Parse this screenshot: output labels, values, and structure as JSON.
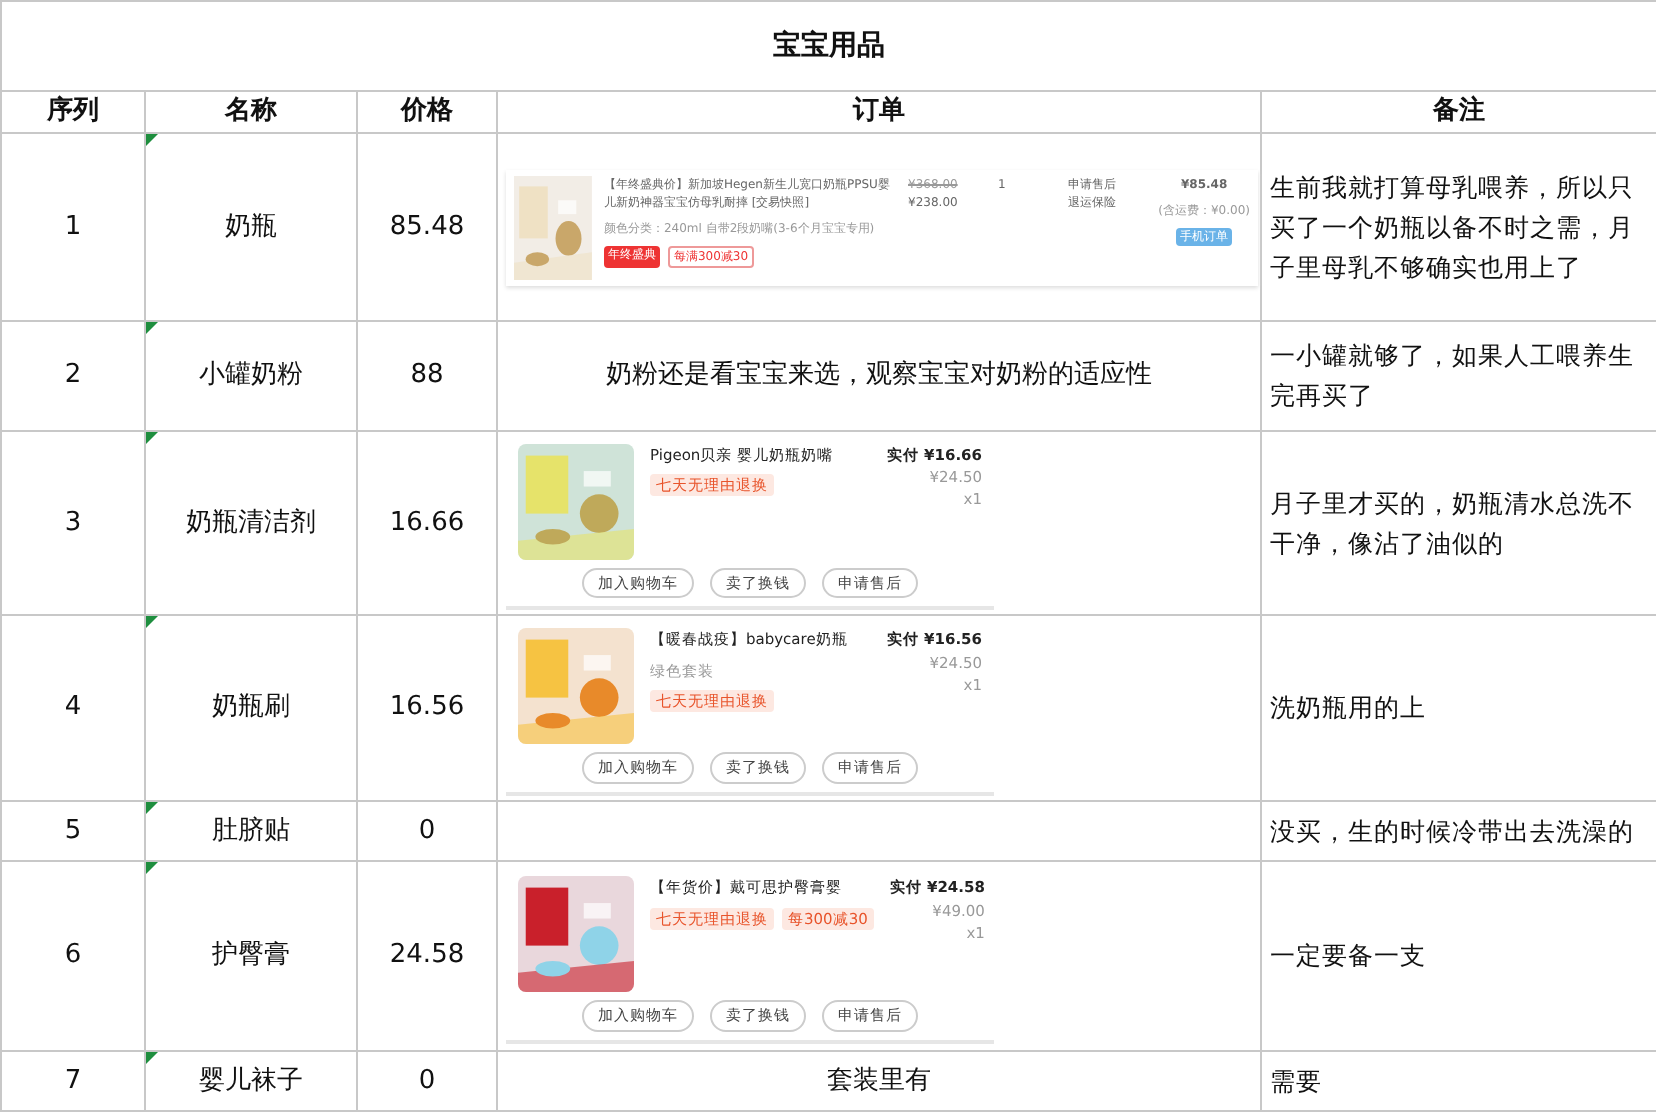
{
  "title": "宝宝用品",
  "columns": [
    "序列",
    "名称",
    "价格",
    "订单",
    "备注"
  ],
  "rows": [
    {
      "index": "1",
      "name": "奶瓶",
      "commented": true,
      "price": "85.48",
      "order": {
        "kind": "desktop",
        "title": "【年终盛典价】新加坡Hegen新生儿宽口奶瓶PPSU婴儿新奶神器宝宝仿母乳耐摔 [交易快照]",
        "variant": "颜色分类：240ml 自带2段奶嘴(3-6个月宝宝专用)",
        "tags": [
          "年终盛典",
          "每满300减30"
        ],
        "original": "¥368.00",
        "price": "¥238.00",
        "qty": "1",
        "links": [
          "申请售后",
          "退运保险"
        ],
        "total": "¥85.48",
        "shipping": "(含运费：¥0.00)",
        "badge": "手机订单"
      },
      "note": "生前我就打算母乳喂养，所以只买了一个奶瓶以备不时之需，月子里母乳不够确实也用上了"
    },
    {
      "index": "2",
      "name": "小罐奶粉",
      "commented": true,
      "price": "88",
      "order": {
        "kind": "text",
        "text": "奶粉还是看宝宝来选，观察宝宝对奶粉的适应性"
      },
      "note": "一小罐就够了，如果人工喂养生完再买了"
    },
    {
      "index": "3",
      "name": "奶瓶清洁剂",
      "commented": true,
      "price": "16.66",
      "order": {
        "kind": "mobile",
        "title": "Pigeon贝亲 婴儿奶瓶奶嘴",
        "tags": [
          "七天无理由退换"
        ],
        "paid": "实付 ¥16.66",
        "original": "¥24.50",
        "qty": "x1",
        "buttons": [
          "加入购物车",
          "卖了换钱",
          "申请售后"
        ]
      },
      "note": "月子里才买的，奶瓶清水总洗不干净，像沾了油似的"
    },
    {
      "index": "4",
      "name": "奶瓶刷",
      "commented": true,
      "price": "16.56",
      "order": {
        "kind": "mobile",
        "title": "【暖春战疫】babycare奶瓶",
        "variant": "绿色套装",
        "tags": [
          "七天无理由退换"
        ],
        "paid": "实付 ¥16.56",
        "original": "¥24.50",
        "qty": "x1",
        "buttons": [
          "加入购物车",
          "卖了换钱",
          "申请售后"
        ]
      },
      "note": "洗奶瓶用的上"
    },
    {
      "index": "5",
      "name": "肚脐贴",
      "commented": true,
      "price": "0",
      "note": "没买，生的时候冷带出去洗澡的"
    },
    {
      "index": "6",
      "name": "护臀膏",
      "commented": true,
      "price": "24.58",
      "order": {
        "kind": "mobile",
        "title": "【年货价】戴可思护臀膏婴",
        "tags": [
          "七天无理由退换",
          "每300减30"
        ],
        "paid": "实付 ¥24.58",
        "original": "¥49.00",
        "qty": "x1",
        "buttons": [
          "加入购物车",
          "卖了换钱",
          "申请售后"
        ]
      },
      "note": "一定要备一支"
    },
    {
      "index": "7",
      "name": "婴儿袜子",
      "commented": true,
      "price": "0",
      "order": {
        "kind": "text",
        "text": "套装里有"
      },
      "note": "需要"
    }
  ]
}
